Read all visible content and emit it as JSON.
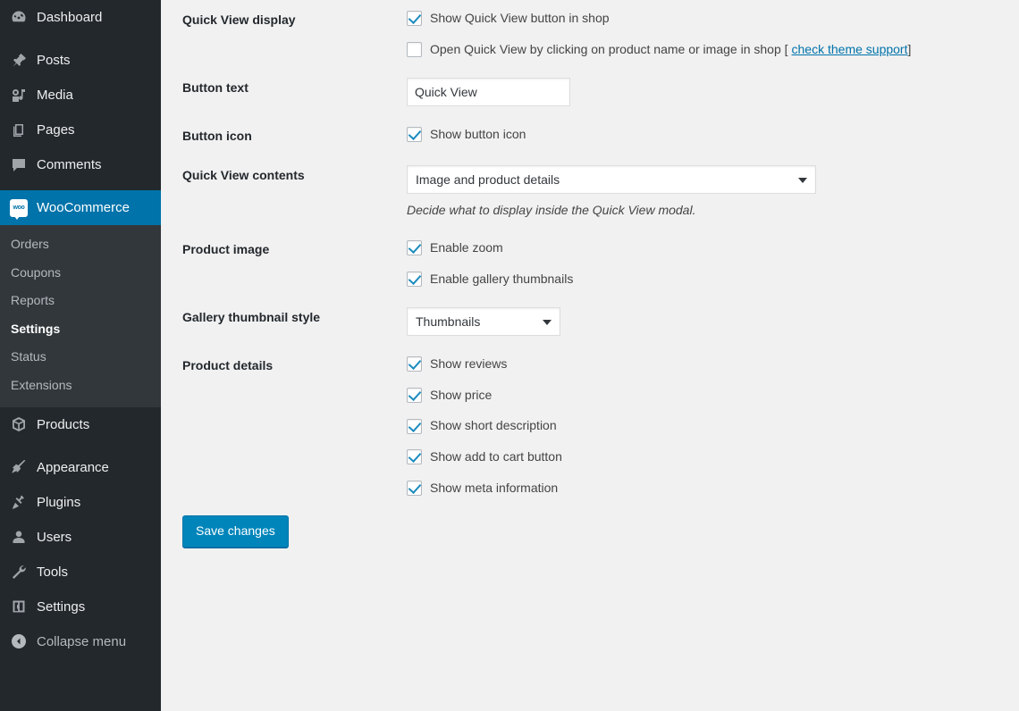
{
  "sidebar": {
    "items": [
      {
        "label": "Dashboard",
        "icon": "dashboard-icon",
        "name": "dashboard"
      },
      {
        "label": "Posts",
        "icon": "pin-icon",
        "name": "posts"
      },
      {
        "label": "Media",
        "icon": "media-icon",
        "name": "media"
      },
      {
        "label": "Pages",
        "icon": "pages-icon",
        "name": "pages"
      },
      {
        "label": "Comments",
        "icon": "comments-icon",
        "name": "comments"
      },
      {
        "label": "WooCommerce",
        "icon": "woocommerce-icon",
        "name": "woocommerce",
        "current": true
      },
      {
        "label": "Products",
        "icon": "products-icon",
        "name": "products"
      },
      {
        "label": "Appearance",
        "icon": "appearance-icon",
        "name": "appearance"
      },
      {
        "label": "Plugins",
        "icon": "plugins-icon",
        "name": "plugins"
      },
      {
        "label": "Users",
        "icon": "users-icon",
        "name": "users"
      },
      {
        "label": "Tools",
        "icon": "tools-icon",
        "name": "tools"
      },
      {
        "label": "Settings",
        "icon": "settings-icon",
        "name": "settings"
      }
    ],
    "submenu": [
      {
        "label": "Orders",
        "name": "orders"
      },
      {
        "label": "Coupons",
        "name": "coupons"
      },
      {
        "label": "Reports",
        "name": "reports"
      },
      {
        "label": "Settings",
        "name": "settings",
        "current": true
      },
      {
        "label": "Status",
        "name": "status"
      },
      {
        "label": "Extensions",
        "name": "extensions"
      }
    ],
    "collapse_label": "Collapse menu",
    "woo_badge_text": "woo",
    "active_color": "#0073aa",
    "background": "#23282d",
    "submenu_background": "#32373c"
  },
  "settings": {
    "quick_view_display": {
      "label": "Quick View display",
      "options": [
        {
          "label": "Show Quick View button in shop",
          "checked": true
        },
        {
          "label": "Open Quick View by clicking on product name or image in shop [",
          "checked": false,
          "link": "check theme support",
          "suffix": "]"
        }
      ]
    },
    "button_text": {
      "label": "Button text",
      "value": "Quick View",
      "placeholder": "Quick View"
    },
    "button_icon": {
      "label": "Button icon",
      "options": [
        {
          "label": "Show button icon",
          "checked": true
        }
      ]
    },
    "quick_view_contents": {
      "label": "Quick View contents",
      "value": "Image and product details",
      "description": "Decide what to display inside the Quick View modal."
    },
    "product_image": {
      "label": "Product image",
      "options": [
        {
          "label": "Enable zoom",
          "checked": true
        },
        {
          "label": "Enable gallery thumbnails",
          "checked": true
        }
      ]
    },
    "gallery_thumbnail_style": {
      "label": "Gallery thumbnail style",
      "value": "Thumbnails"
    },
    "product_details": {
      "label": "Product details",
      "options": [
        {
          "label": "Show reviews",
          "checked": true
        },
        {
          "label": "Show price",
          "checked": true
        },
        {
          "label": "Show short description",
          "checked": true
        },
        {
          "label": "Show add to cart button",
          "checked": true
        },
        {
          "label": "Show meta information",
          "checked": true
        }
      ]
    },
    "save_label": "Save changes",
    "link_color": "#0073aa",
    "button_color": "#0085ba"
  }
}
